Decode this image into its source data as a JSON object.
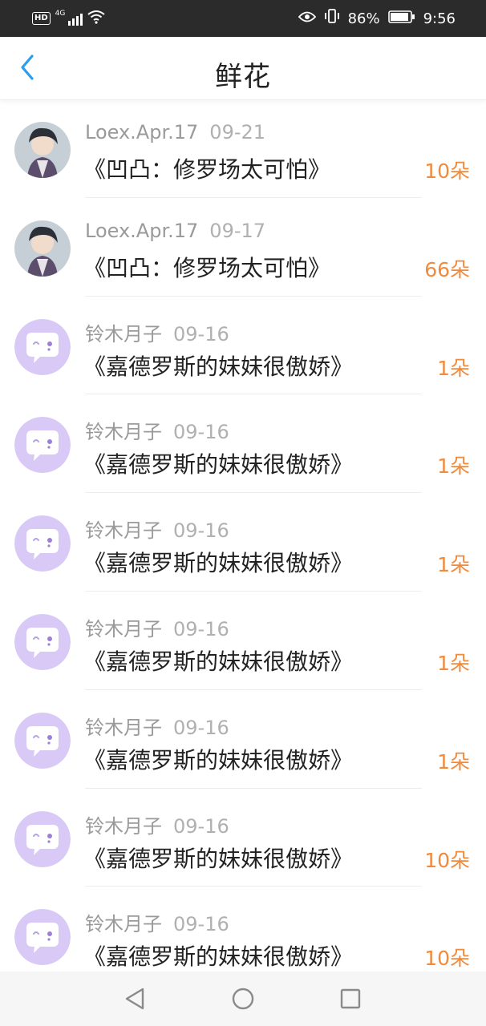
{
  "status_bar": {
    "hd_label": "HD",
    "network_label": "4G",
    "battery": "86%",
    "time": "9:56"
  },
  "header": {
    "title": "鲜花",
    "back_icon": "chevron-left-icon"
  },
  "items": [
    {
      "name": "Loex.Apr.17",
      "date": "09-21",
      "title": "《凹凸：修罗场太可怕》",
      "count": "10朵",
      "avatar": "anime-avatar"
    },
    {
      "name": "Loex.Apr.17",
      "date": "09-17",
      "title": "《凹凸：修罗场太可怕》",
      "count": "66朵",
      "avatar": "anime-avatar"
    },
    {
      "name": "铃木月子",
      "date": "09-16",
      "title": "《嘉德罗斯的妹妹很傲娇》",
      "count": "1朵",
      "avatar": "default-chat-avatar"
    },
    {
      "name": "铃木月子",
      "date": "09-16",
      "title": "《嘉德罗斯的妹妹很傲娇》",
      "count": "1朵",
      "avatar": "default-chat-avatar"
    },
    {
      "name": "铃木月子",
      "date": "09-16",
      "title": "《嘉德罗斯的妹妹很傲娇》",
      "count": "1朵",
      "avatar": "default-chat-avatar"
    },
    {
      "name": "铃木月子",
      "date": "09-16",
      "title": "《嘉德罗斯的妹妹很傲娇》",
      "count": "1朵",
      "avatar": "default-chat-avatar"
    },
    {
      "name": "铃木月子",
      "date": "09-16",
      "title": "《嘉德罗斯的妹妹很傲娇》",
      "count": "1朵",
      "avatar": "default-chat-avatar"
    },
    {
      "name": "铃木月子",
      "date": "09-16",
      "title": "《嘉德罗斯的妹妹很傲娇》",
      "count": "10朵",
      "avatar": "default-chat-avatar"
    },
    {
      "name": "铃木月子",
      "date": "09-16",
      "title": "《嘉德罗斯的妹妹很傲娇》",
      "count": "10朵",
      "avatar": "default-chat-avatar"
    }
  ],
  "colors": {
    "accent_blue": "#2b9df0",
    "count_orange": "#f08a3c",
    "avatar_purple": "#d9c9f7"
  },
  "nav_bar": {
    "back_icon": "triangle-back-icon",
    "home_icon": "circle-home-icon",
    "recents_icon": "square-recents-icon"
  }
}
